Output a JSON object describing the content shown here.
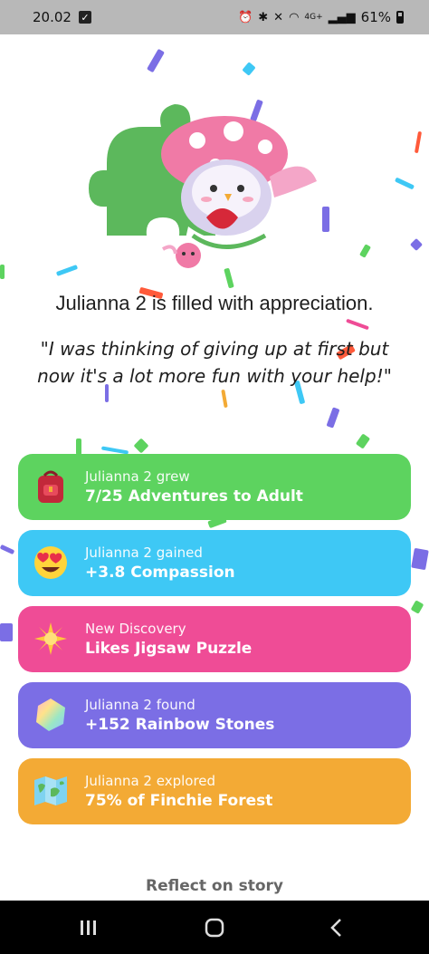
{
  "status_bar": {
    "time": "20.02",
    "network": "4G+",
    "battery": "61%"
  },
  "headline": "Julianna 2 is filled with appreciation.",
  "quote": "\"I was thinking of giving up at first but now it's a lot more fun with your help!\"",
  "cards": [
    {
      "subtitle": "Julianna 2 grew",
      "title": "7/25 Adventures to Adult",
      "color": "#5dd35f",
      "icon": "backpack-icon"
    },
    {
      "subtitle": "Julianna 2 gained",
      "title": "+3.8 Compassion",
      "color": "#3ec8f5",
      "icon": "heart-eyes-emoji-icon"
    },
    {
      "subtitle": "New Discovery",
      "title": "Likes Jigsaw Puzzle",
      "color": "#ef4c96",
      "icon": "sparkle-sun-icon"
    },
    {
      "subtitle": "Julianna 2 found",
      "title": "+152 Rainbow Stones",
      "color": "#7b6ee5",
      "icon": "rainbow-stone-icon"
    },
    {
      "subtitle": "Julianna 2 explored",
      "title": "75% of Finchie Forest",
      "color": "#f3aa35",
      "icon": "map-icon"
    }
  ],
  "reflect_label": "Reflect on story",
  "colors": {
    "confetti": [
      "#7b6ee5",
      "#3ec8f5",
      "#5dd35f",
      "#ef4c96",
      "#f3aa35",
      "#ff5a3a"
    ],
    "puzzle_green": "#5cb85c"
  }
}
